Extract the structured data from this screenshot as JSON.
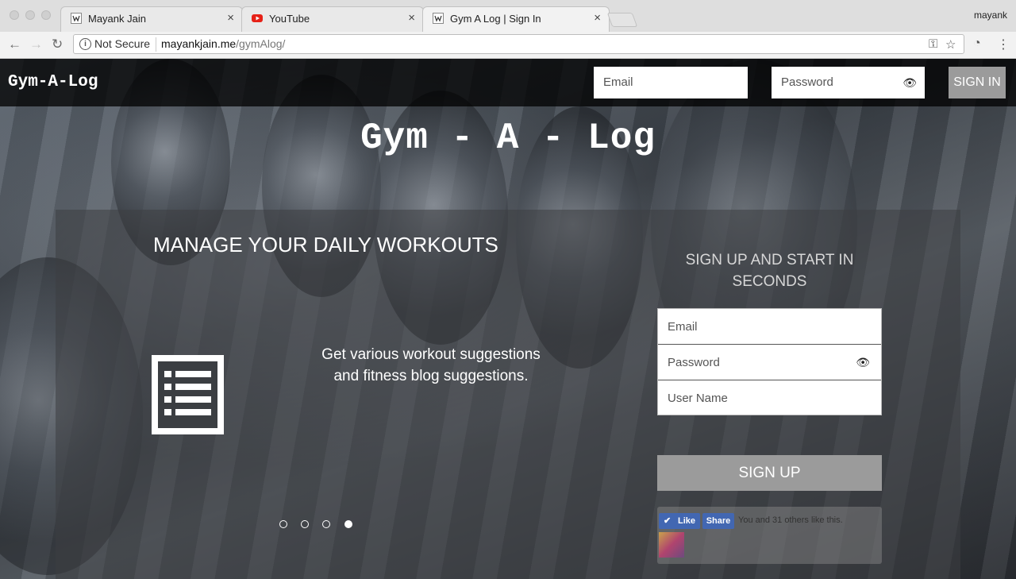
{
  "browser": {
    "tabs": [
      {
        "title": "Mayank Jain",
        "close": "×"
      },
      {
        "title": "YouTube",
        "close": "×"
      },
      {
        "title": "Gym A Log | Sign In",
        "close": "×"
      }
    ],
    "profile_name": "mayank",
    "security_label": "Not Secure",
    "url_host": "mayankjain.me",
    "url_path": "/gymAlog/"
  },
  "nav": {
    "brand": "Gym-A-Log",
    "email_placeholder": "Email",
    "password_placeholder": "Password",
    "signin_label": "SIGN IN"
  },
  "hero": {
    "title": "Gym - A - Log"
  },
  "carousel": {
    "heading": "MANAGE YOUR DAILY WORKOUTS",
    "text": "Get various workout suggestions and fitness blog suggestions.",
    "active_slide": 4,
    "slide_count": 4
  },
  "signup": {
    "heading": "SIGN UP AND START IN SECONDS",
    "email_placeholder": "Email",
    "password_placeholder": "Password",
    "username_placeholder": "User Name",
    "button_label": "SIGN UP"
  },
  "facebook": {
    "like_label": "Like",
    "share_label": "Share",
    "social_text": "You and 31 others like this."
  },
  "colors": {
    "brand_button": "#9b9b9b",
    "facebook_blue": "#4267b2",
    "nav_bg": "#000000"
  }
}
